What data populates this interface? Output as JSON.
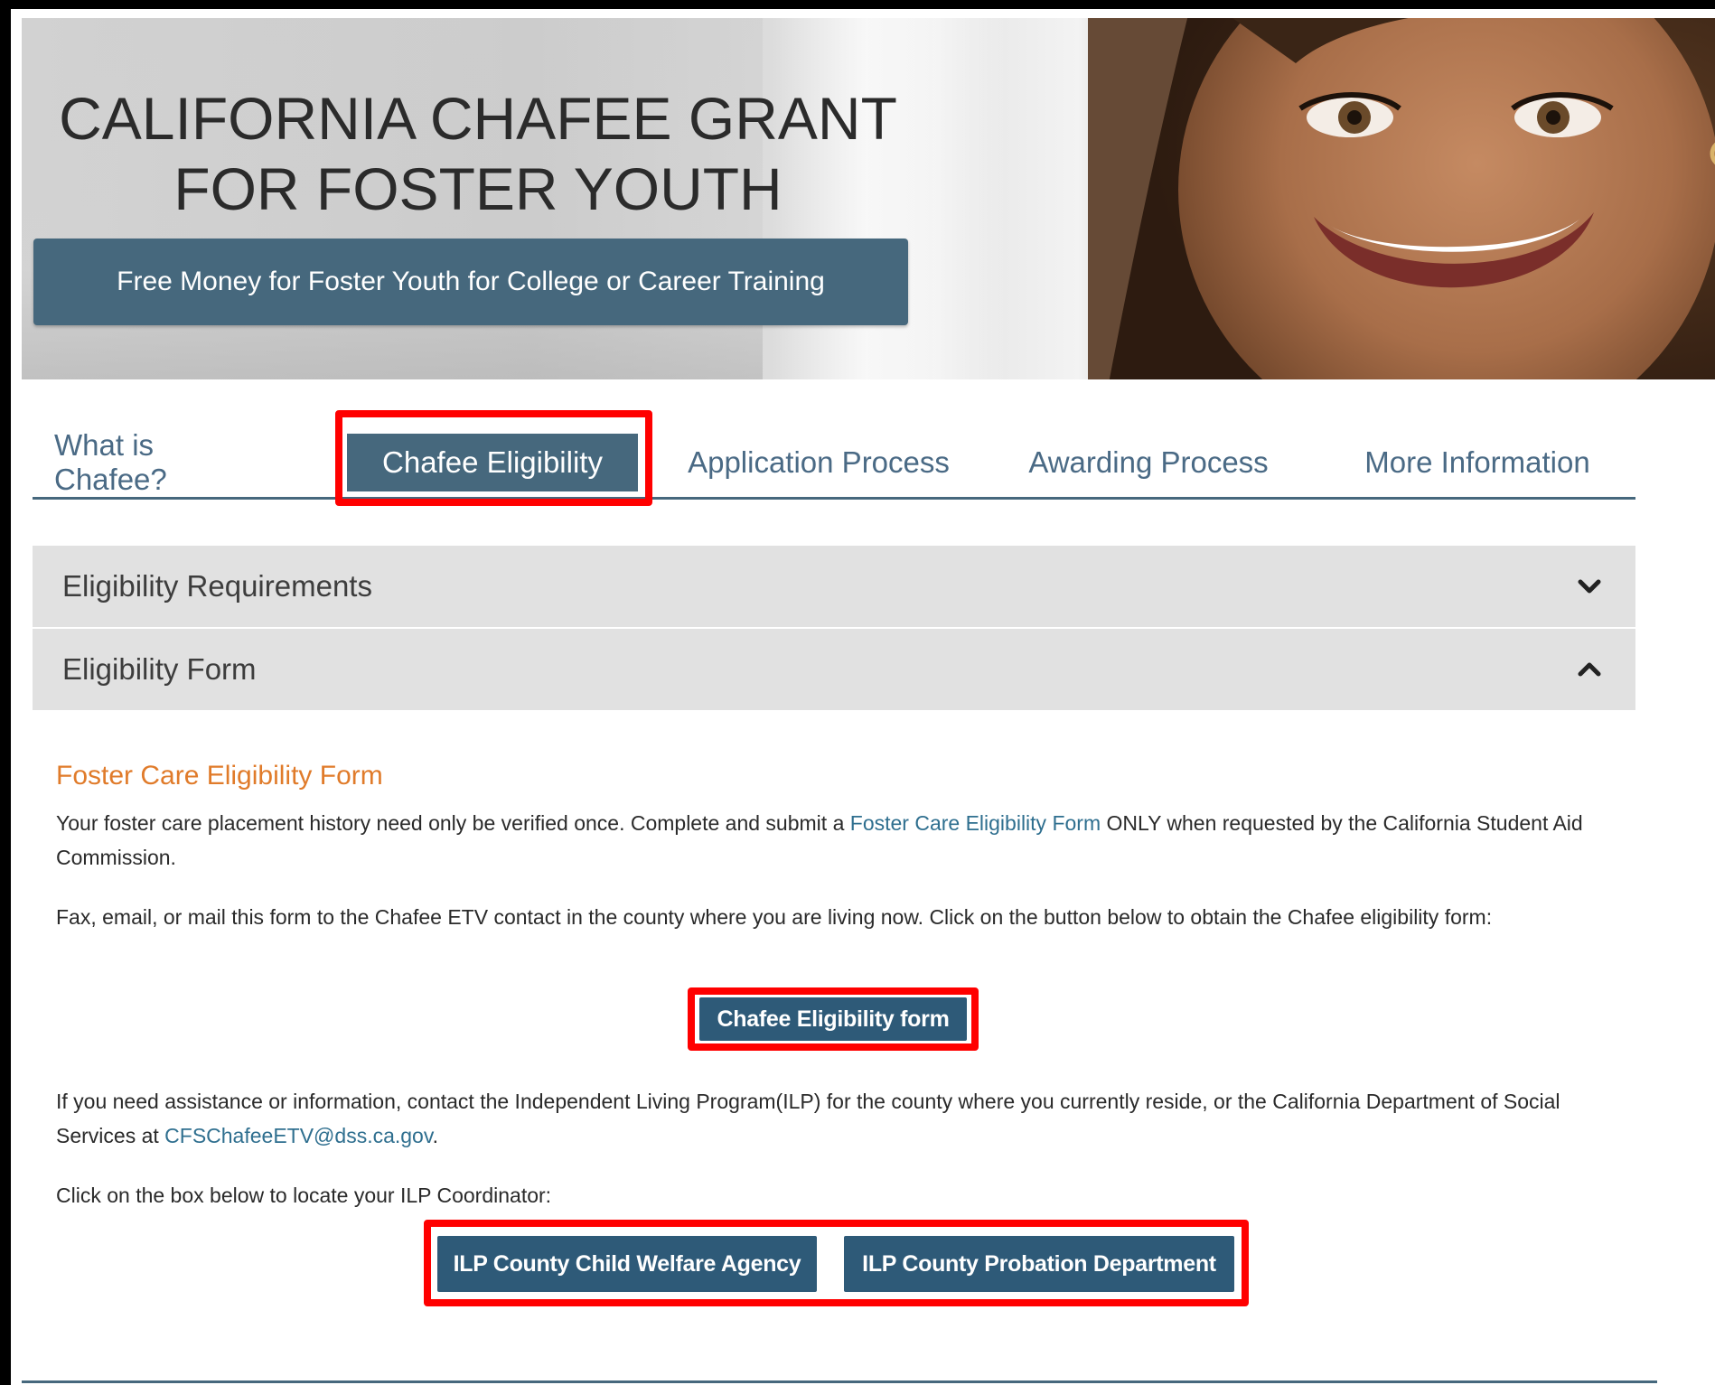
{
  "hero": {
    "title_line1": "CALIFORNIA CHAFEE GRANT",
    "title_line2": "FOR FOSTER YOUTH",
    "tagline": "Free Money for Foster Youth for College or Career Training"
  },
  "tabs": [
    {
      "label": "What is Chafee?"
    },
    {
      "label": "Chafee Eligibility",
      "active": true
    },
    {
      "label": "Application Process"
    },
    {
      "label": "Awarding Process"
    },
    {
      "label": "More Information"
    }
  ],
  "accordion": [
    {
      "label": "Eligibility Requirements",
      "state": "collapsed",
      "icon": "chevron-down-icon"
    },
    {
      "label": "Eligibility Form",
      "state": "expanded",
      "icon": "chevron-up-icon"
    }
  ],
  "content": {
    "heading": "Foster Care Eligibility Form",
    "p1_before": "Your foster care placement history need only be verified once. Complete and submit a ",
    "p1_link": "Foster Care Eligibility Form",
    "p1_after": " ONLY when requested by the California Student Aid Commission.",
    "p2": "Fax, email, or mail this form to the Chafee ETV contact in the county where you are living now. Click on the button below to obtain the Chafee eligibility form:",
    "form_button": "Chafee Eligibility form",
    "p3_before": "If you need assistance or information, contact the Independent Living Program(ILP) for the county where you currently reside, or the California Department of Social Services at ",
    "p3_link": "CFSChafeeETV@dss.ca.gov",
    "p3_after": ".",
    "p4": "Click on the box below to locate your ILP Coordinator:",
    "ilp_button_1": "ILP County Child Welfare Agency",
    "ilp_button_2": "ILP County Probation Department"
  },
  "colors": {
    "primary": "#46687d",
    "button": "#2e5a78",
    "heading_accent": "#e07b2a",
    "link": "#2f6f8f",
    "highlight": "#ff0000"
  }
}
